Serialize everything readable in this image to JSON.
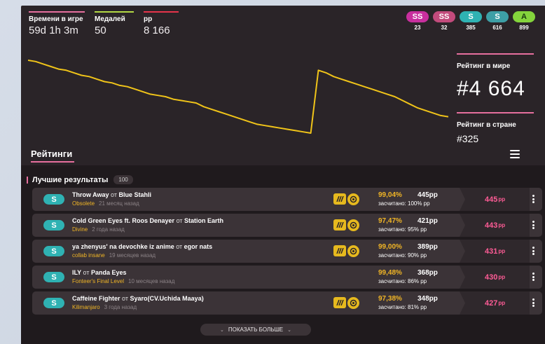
{
  "stats": {
    "play_time": {
      "label": "Времени в игре",
      "value": "59d 1h 3m",
      "color": "#e66f9e"
    },
    "medals": {
      "label": "Медалей",
      "value": "50",
      "color": "#b3d944"
    },
    "pp": {
      "label": "pp",
      "value": "8 166",
      "color": "#e6344a"
    }
  },
  "grades": [
    {
      "label": "SS",
      "count": "23",
      "color": "#c82f9e"
    },
    {
      "label": "SS",
      "count": "32",
      "color": "#c24b7c"
    },
    {
      "label": "S",
      "count": "385",
      "color": "#2fb2b3"
    },
    {
      "label": "S",
      "count": "616",
      "color": "#3d9fa6"
    },
    {
      "label": "A",
      "count": "899",
      "color": "#84d43c"
    }
  ],
  "rank_world": {
    "label": "Рейтинг в мире",
    "value": "#4 664"
  },
  "rank_country": {
    "label": "Рейтинг в стране",
    "value": "#325"
  },
  "rank_history": [
    100,
    99,
    97,
    95,
    93,
    92,
    90,
    88,
    87,
    85,
    83,
    82,
    80,
    79,
    77,
    75,
    73,
    72,
    71,
    69,
    68,
    67,
    66,
    63,
    61,
    59,
    57,
    55,
    53,
    51,
    49,
    48,
    47,
    46,
    45,
    44,
    43,
    42,
    92,
    90,
    87,
    85,
    83,
    81,
    79,
    77,
    75,
    73,
    71,
    68,
    65,
    62,
    60,
    58,
    56,
    55
  ],
  "section_title": "Рейтинги",
  "best": {
    "title": "Лучшие результаты",
    "count": "100",
    "items": [
      {
        "grade": "S",
        "title": "Throw Away",
        "by": "от",
        "artist": "Blue Stahli",
        "diff": "Obsolete",
        "ago": "21 месяц назад",
        "acc": "99,04%",
        "pp": "445pp",
        "weighted": "засчитано: 100% pp",
        "final_pp": "445",
        "unit": "pp"
      },
      {
        "grade": "S",
        "title": "Cold Green Eyes ft. Roos Denayer",
        "by": "от",
        "artist": "Station Earth",
        "diff": "Divine",
        "ago": "2 года назад",
        "acc": "97,47%",
        "pp": "421pp",
        "weighted": "засчитано: 95% pp",
        "final_pp": "443",
        "unit": "pp"
      },
      {
        "grade": "S",
        "title": "ya zhenyus' na devochke iz anime",
        "by": "от",
        "artist": "egor nats",
        "diff": "collab insane",
        "ago": "19 месяцев назад",
        "acc": "99,00%",
        "pp": "389pp",
        "weighted": "засчитано: 90% pp",
        "final_pp": "431",
        "unit": "pp"
      },
      {
        "grade": "S",
        "title": "ILY",
        "by": "от",
        "artist": "Panda Eyes",
        "diff": "Fonteer's Final Level",
        "ago": "10 месяцев назад",
        "acc": "99,48%",
        "pp": "368pp",
        "weighted": "засчитано: 86% pp",
        "final_pp": "430",
        "unit": "pp"
      },
      {
        "grade": "S",
        "title": "Caffeine Fighter",
        "by": "от",
        "artist": "Syaro(CV.Uchida Maaya)",
        "diff": "Kilimanjaro",
        "ago": "3 года назад",
        "acc": "97,38%",
        "pp": "348pp",
        "weighted": "засчитано: 81% pp",
        "final_pp": "427",
        "unit": "pp"
      }
    ]
  },
  "show_more": "ПОКАЗАТЬ БОЛЬШЕ",
  "colors": {
    "accent": "#e66f9e",
    "gold": "#f0b526",
    "pp": "#ff5c96",
    "graph": "#f0c419"
  }
}
